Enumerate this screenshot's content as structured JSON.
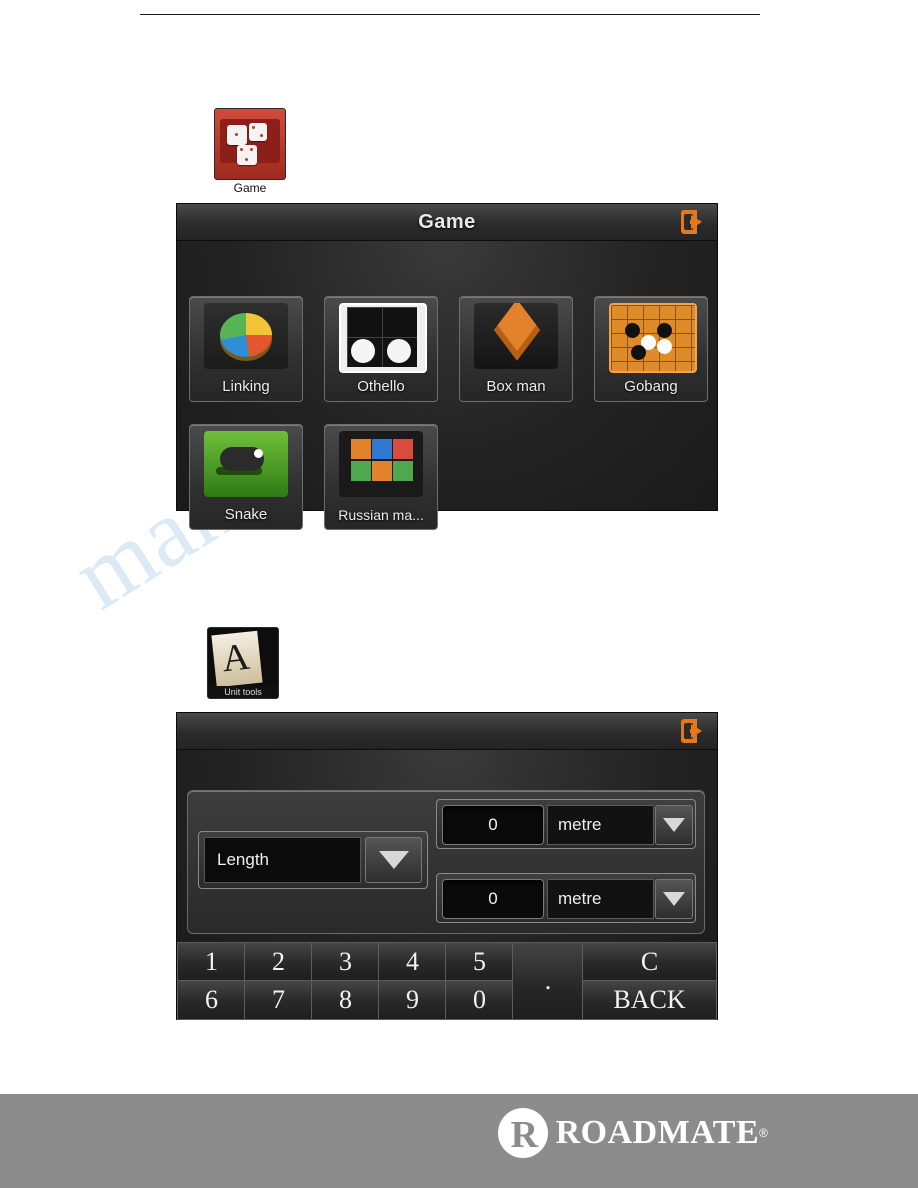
{
  "watermark": {
    "text": "manualshive.com"
  },
  "desktop_icons": [
    {
      "name": "game",
      "label": "Game"
    },
    {
      "name": "unit-tools",
      "label": "Unit tools"
    }
  ],
  "game_screen": {
    "title": "Game",
    "exit_icon": "exit-icon",
    "tiles": [
      {
        "label": "Linking",
        "icon": "pie-chart-icon"
      },
      {
        "label": "Othello",
        "icon": "othello-board-icon"
      },
      {
        "label": "Box man",
        "icon": "box-cube-icon"
      },
      {
        "label": "Gobang",
        "icon": "gobang-board-icon"
      },
      {
        "label": "Snake",
        "icon": "snake-icon"
      },
      {
        "label": "Russian ma...",
        "icon": "tetris-blocks-icon"
      }
    ]
  },
  "unit_screen": {
    "exit_icon": "exit-icon",
    "category": {
      "value": "Length",
      "dropdown_icon": "chevron-down-icon"
    },
    "rows": [
      {
        "value": "0",
        "unit": "metre",
        "dropdown_icon": "chevron-down-icon"
      },
      {
        "value": "0",
        "unit": "metre",
        "dropdown_icon": "chevron-down-icon"
      }
    ],
    "keypad_row1": [
      "1",
      "2",
      "3",
      "4",
      "5"
    ],
    "keypad_row2": [
      "6",
      "7",
      "8",
      "9",
      "0"
    ],
    "dot_key": ".",
    "clear_key": "C",
    "back_key": "BACK"
  },
  "footer": {
    "brand_name": "ROADMATE",
    "brand_mark": "R",
    "registered": "®"
  }
}
